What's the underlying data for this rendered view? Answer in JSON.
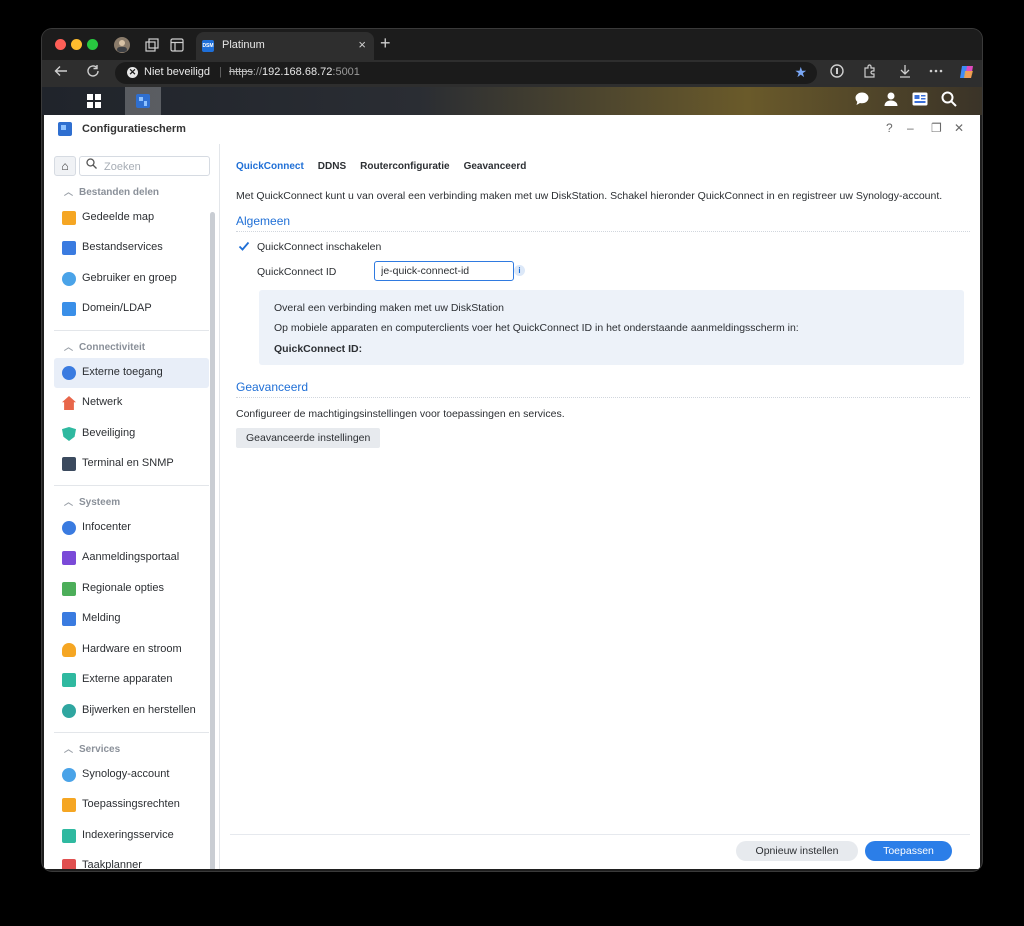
{
  "browser": {
    "tab_title": "Platinum",
    "tab_favicon_text": "DSM",
    "tab_close": "×",
    "new_tab": "+",
    "not_secure": "Niet beveiligd",
    "url_scheme": "https",
    "url_sep": "://",
    "url_host": "192.168.68.72",
    "url_port": ":5001",
    "icons": [
      "back-icon",
      "reload-icon",
      "star-icon",
      "extension-icon",
      "download-icon",
      "more-icon",
      "copilot-icon"
    ]
  },
  "window": {
    "title": "Configuratiescherm",
    "help": "?",
    "minimize": "–",
    "restore": "❐",
    "close": "✕"
  },
  "sidebar": {
    "search_placeholder": "Zoeken",
    "sections": [
      {
        "title": "Bestanden delen",
        "items": [
          "Gedeelde map",
          "Bestandservices",
          "Gebruiker en groep",
          "Domein/LDAP"
        ]
      },
      {
        "title": "Connectiviteit",
        "items": [
          "Externe toegang",
          "Netwerk",
          "Beveiliging",
          "Terminal en SNMP"
        ]
      },
      {
        "title": "Systeem",
        "items": [
          "Infocenter",
          "Aanmeldingsportaal",
          "Regionale opties",
          "Melding",
          "Hardware en stroom",
          "Externe apparaten",
          "Bijwerken en herstellen"
        ]
      },
      {
        "title": "Services",
        "items": [
          "Synology-account",
          "Toepassingsrechten",
          "Indexeringsservice",
          "Taakplanner"
        ]
      }
    ],
    "active_item": "Externe toegang"
  },
  "main": {
    "tabs": [
      "QuickConnect",
      "DDNS",
      "Routerconfiguratie",
      "Geavanceerd"
    ],
    "active_tab": "QuickConnect",
    "intro": "Met QuickConnect kunt u van overal een verbinding maken met uw DiskStation. Schakel hieronder QuickConnect in en registreer uw Synology-account.",
    "general_title": "Algemeen",
    "enable_label": "QuickConnect inschakelen",
    "enable_checked": true,
    "id_label": "QuickConnect ID",
    "id_value": "je-quick-connect-id",
    "info_icon": "i",
    "info": {
      "line1": "Overal een verbinding maken met uw DiskStation",
      "line2": "Op mobiele apparaten en computerclients voer het QuickConnect ID in het onderstaande aanmeldingsscherm in:",
      "line3": "QuickConnect ID:"
    },
    "advanced_title": "Geavanceerd",
    "advanced_desc": "Configureer de machtigingsinstellingen voor toepassingen en services.",
    "advanced_button": "Geavanceerde instellingen",
    "reset_button": "Opnieuw instellen",
    "apply_button": "Toepassen"
  },
  "colors": {
    "accent": "#1f6fd6",
    "apply": "#2b7ee8",
    "active_nav_bg": "#e8eef8",
    "info_panel_bg": "#edf2f9"
  }
}
